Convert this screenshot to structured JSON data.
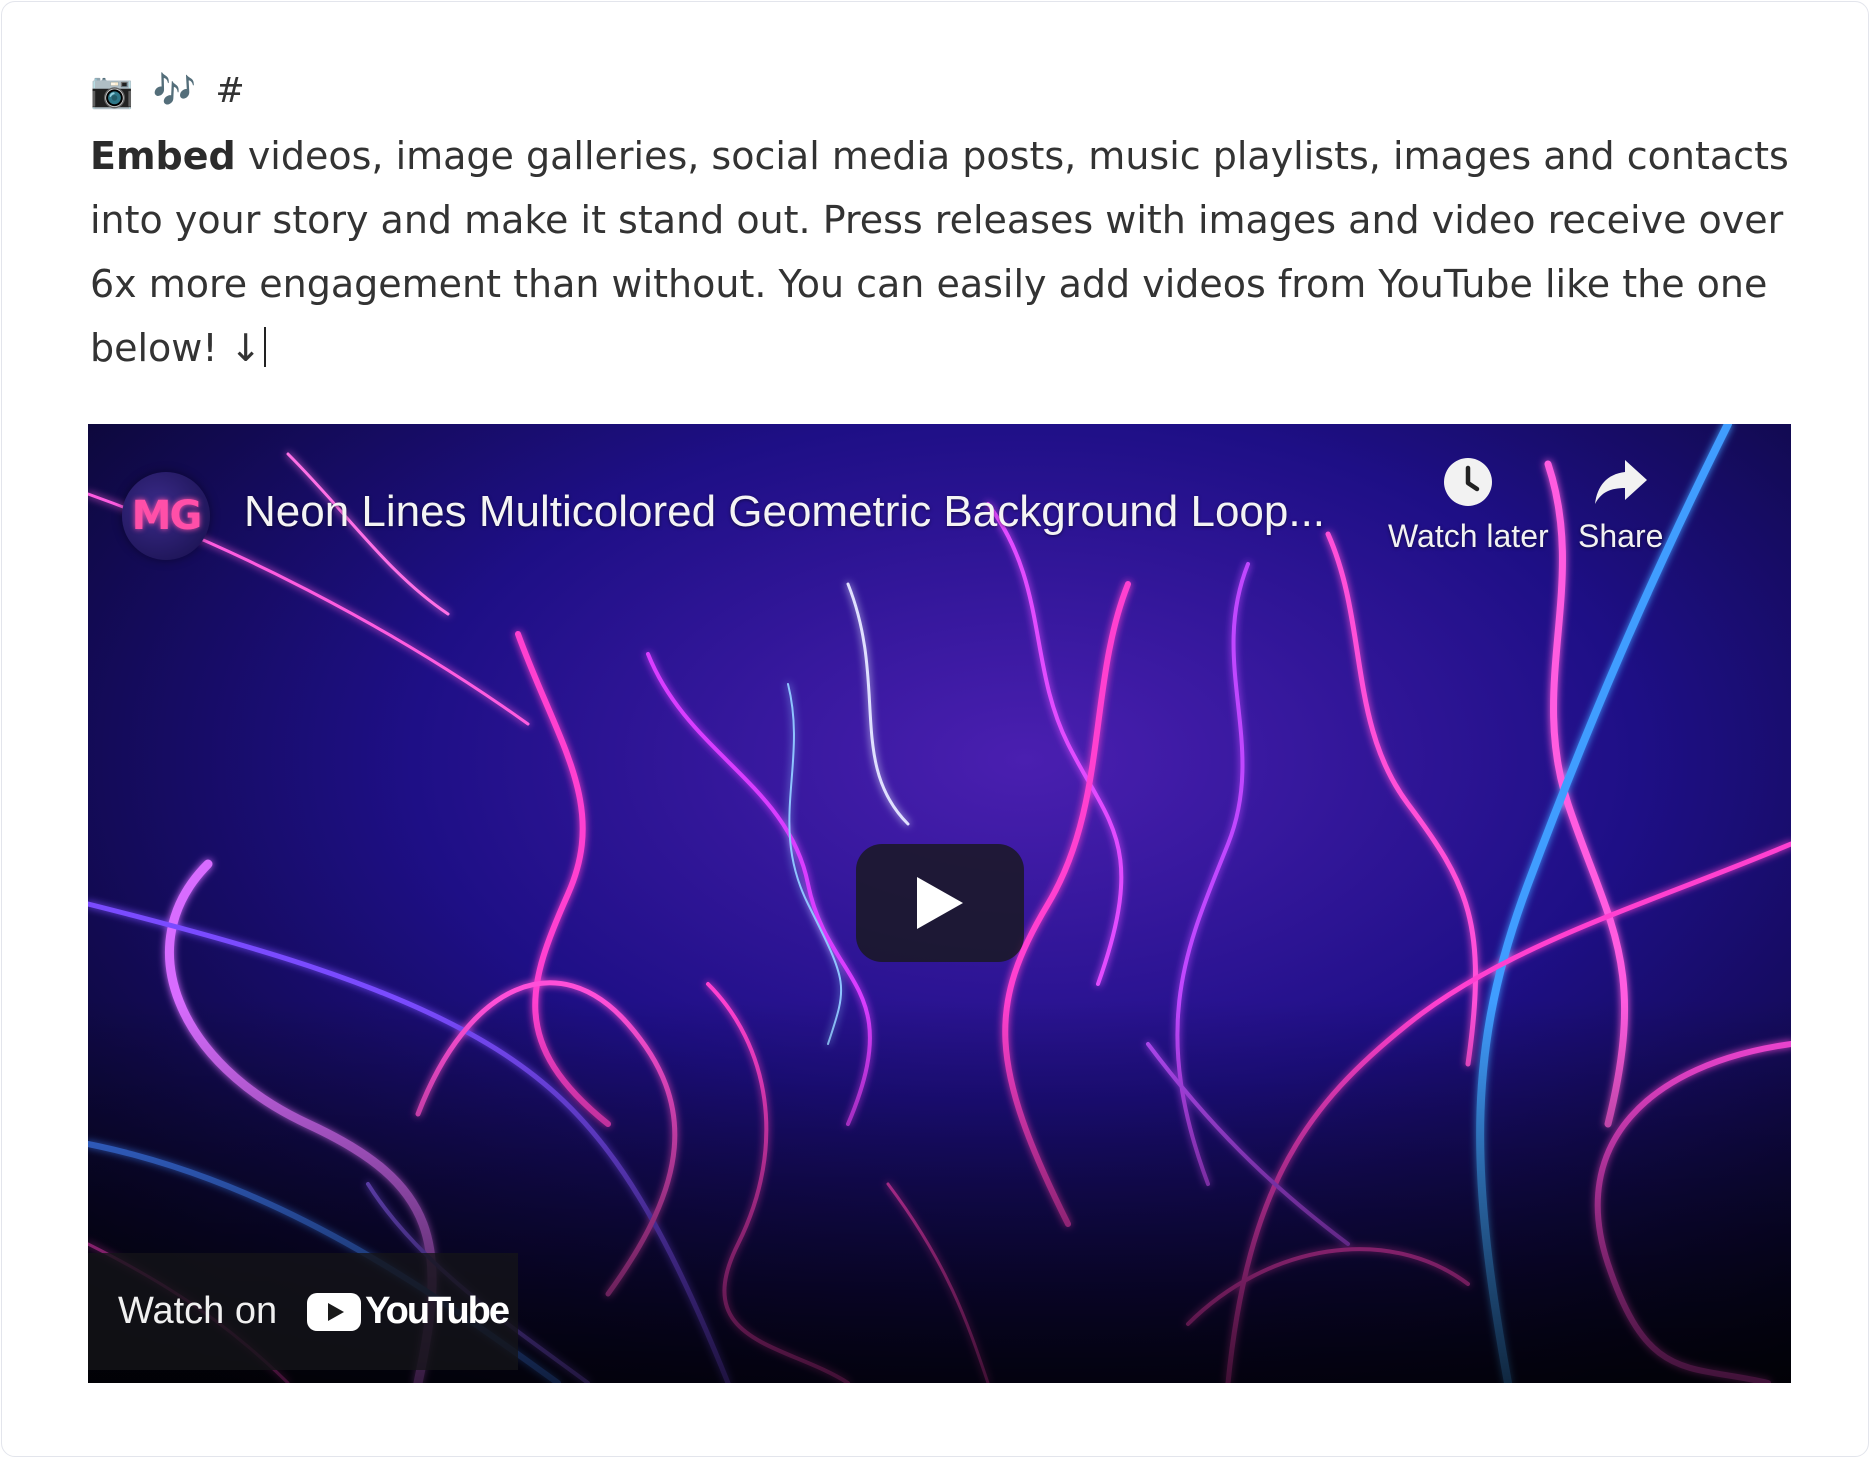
{
  "editor": {
    "emoji_row": "📷 🎶 #",
    "paragraph_bold": "Embed",
    "paragraph_rest": " videos, image galleries, social media posts, music playlists, images and contacts into your story and make it stand out. Press releases with images and video receive over 6x more engagement than without. You can easily add videos from YouTube like the one below! ↓"
  },
  "video": {
    "title": "Neon Lines Multicolored Geometric Background Loop...",
    "channel_logo_text": "MG",
    "watch_later_label": "Watch later",
    "share_label": "Share",
    "watch_on_label": "Watch on",
    "youtube_label": "YouTube",
    "colors": {
      "background_dark": "#0a0a3a",
      "neon_magenta": "#ff3fd0",
      "neon_violet": "#b04cff",
      "neon_blue": "#3f8cff",
      "youtube_red": "#ff0000"
    }
  }
}
